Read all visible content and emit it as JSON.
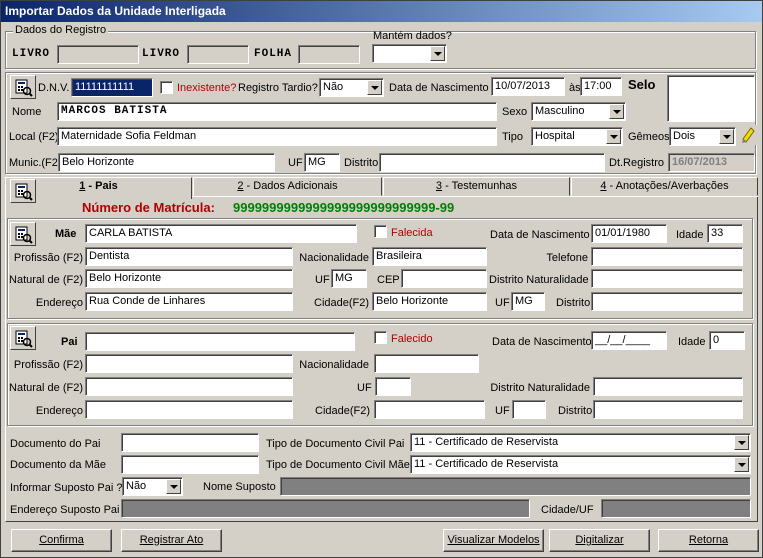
{
  "window": {
    "title": "Importar Dados da Unidade Interligada"
  },
  "registro": {
    "group_label": "Dados do Registro",
    "livro1_label": "LIVRO",
    "livro2_label": "LIVRO",
    "folha_label": "FOLHA",
    "mantem_label": "Mantém dados?",
    "mantem_value": ""
  },
  "header": {
    "dnv_label": "D.N.V.",
    "dnv_value": "11111111111",
    "inexistente_label": "Inexistente?",
    "registro_tardio_label": "Registro Tardio?",
    "registro_tardio_value": "Não",
    "data_nasc_label": "Data de Nascimento",
    "data_nasc_value": "10/07/2013",
    "as_label": "às",
    "hora_value": "17:00",
    "selo_label": "Selo",
    "nome_label": "Nome",
    "nome_value": "MARCOS BATISTA",
    "sexo_label": "Sexo",
    "sexo_value": "Masculino",
    "local_label": "Local (F2)",
    "local_value": "Maternidade Sofia Feldman",
    "tipo_label": "Tipo",
    "tipo_value": "Hospital",
    "gemeos_label": "Gêmeos",
    "gemeos_value": "Dois",
    "munic_label": "Munic.(F2)",
    "munic_value": "Belo Horizonte",
    "uf_label": "UF",
    "uf_value": "MG",
    "distrito_label": "Distrito",
    "distrito_value": "",
    "dtregistro_label": "Dt.Registro",
    "dtregistro_value": "16/07/2013"
  },
  "tabs": [
    {
      "num": "1",
      "label": " - Pais"
    },
    {
      "num": "2",
      "label": " - Dados Adicionais"
    },
    {
      "num": "3",
      "label": " - Testemunhas"
    },
    {
      "num": "4",
      "label": " - Anotações/Averbações"
    }
  ],
  "matricula": {
    "label": "Número de Matrícula:",
    "value": "9999999999999999999999999999-99"
  },
  "mae": {
    "title": "Mãe",
    "nome_value": "CARLA BATISTA",
    "falecida_label": "Falecida",
    "data_nasc_label": "Data de Nascimento",
    "data_nasc_value": "01/01/1980",
    "idade_label": "Idade",
    "idade_value": "33",
    "profissao_label": "Profissão (F2)",
    "profissao_value": "Dentista",
    "nacionalidade_label": "Nacionalidade",
    "nacionalidade_value": "Brasileira",
    "telefone_label": "Telefone",
    "telefone_value": "",
    "natural_label": "Natural de (F2)",
    "natural_value": "Belo Horizonte",
    "uf_label": "UF",
    "uf_value": "MG",
    "cep_label": "CEP",
    "cep_value": "",
    "distrito_nat_label": "Distrito Naturalidade",
    "distrito_nat_value": "",
    "endereco_label": "Endereço",
    "endereco_value": "Rua Conde de Linhares",
    "cidade_label": "Cidade(F2)",
    "cidade_value": "Belo Horizonte",
    "uf2_label": "UF",
    "uf2_value": "MG",
    "distrito_label": "Distrito",
    "distrito_value": ""
  },
  "pai": {
    "title": "Pai",
    "nome_value": "",
    "falecido_label": "Falecido",
    "data_nasc_label": "Data de Nascimento",
    "data_nasc_value": "__/__/____",
    "idade_label": "Idade",
    "idade_value": "0",
    "profissao_label": "Profissão (F2)",
    "nacionalidade_label": "Nacionalidade",
    "natural_label": "Natural de (F2)",
    "uf_label": "UF",
    "distrito_nat_label": "Distrito Naturalidade",
    "endereco_label": "Endereço",
    "cidade_label": "Cidade(F2)",
    "uf2_label": "UF",
    "distrito_label": "Distrito"
  },
  "docs": {
    "doc_pai_label": "Documento do Pai",
    "doc_mae_label": "Documento da Mãe",
    "tipo_doc_pai_label": "Tipo de Documento Civil Pai",
    "tipo_doc_pai_value": "11 - Certificado de Reservista",
    "tipo_doc_mae_label": "Tipo de Documento Civil Mãe",
    "tipo_doc_mae_value": "11 - Certificado de Reservista",
    "suposto_pai_label": "Informar Suposto Pai ?",
    "suposto_pai_value": "Não",
    "nome_suposto_label": "Nome Suposto",
    "endereco_suposto_label": "Endereço Suposto Pai",
    "cidade_uf_label": "Cidade/UF"
  },
  "buttons": {
    "confirma": "Confirma",
    "registrar_ato": "Registrar Ato",
    "visualizar_modelos": "Visualizar Modelos",
    "digitalizar": "Digitalizar",
    "retorna": "Retorna"
  }
}
